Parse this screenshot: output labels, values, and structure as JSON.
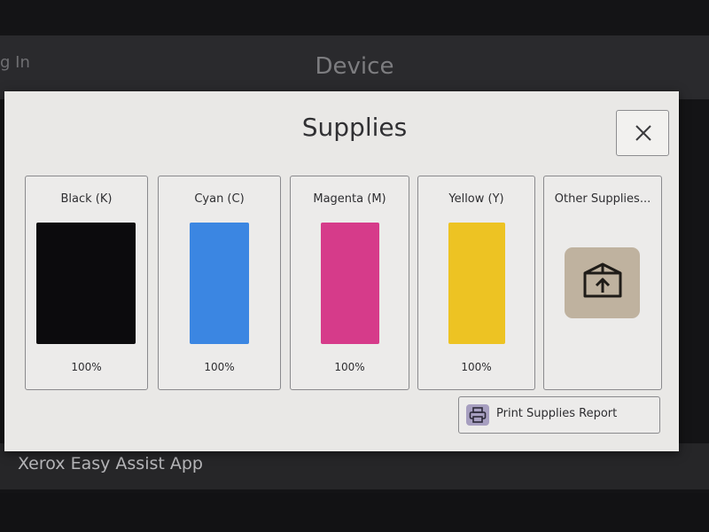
{
  "background": {
    "title": "Device",
    "left_partial": "g In",
    "row_item": "Xerox Easy Assist App"
  },
  "dialog": {
    "title": "Supplies",
    "close_icon": "close-icon"
  },
  "supplies": [
    {
      "label": "Black (K)",
      "percent": "100%",
      "level": 1.0,
      "color": "#0c0b0d"
    },
    {
      "label": "Cyan (C)",
      "percent": "100%",
      "level": 1.0,
      "color": "#3b86e2"
    },
    {
      "label": "Magenta (M)",
      "percent": "100%",
      "level": 1.0,
      "color": "#d63b8a"
    },
    {
      "label": "Yellow (Y)",
      "percent": "100%",
      "level": 1.0,
      "color": "#edc323"
    }
  ],
  "other_supplies": {
    "label": "Other Supplies...",
    "icon": "box-upload-icon"
  },
  "report_button": {
    "label": "Print Supplies Report",
    "icon": "printer-icon"
  }
}
